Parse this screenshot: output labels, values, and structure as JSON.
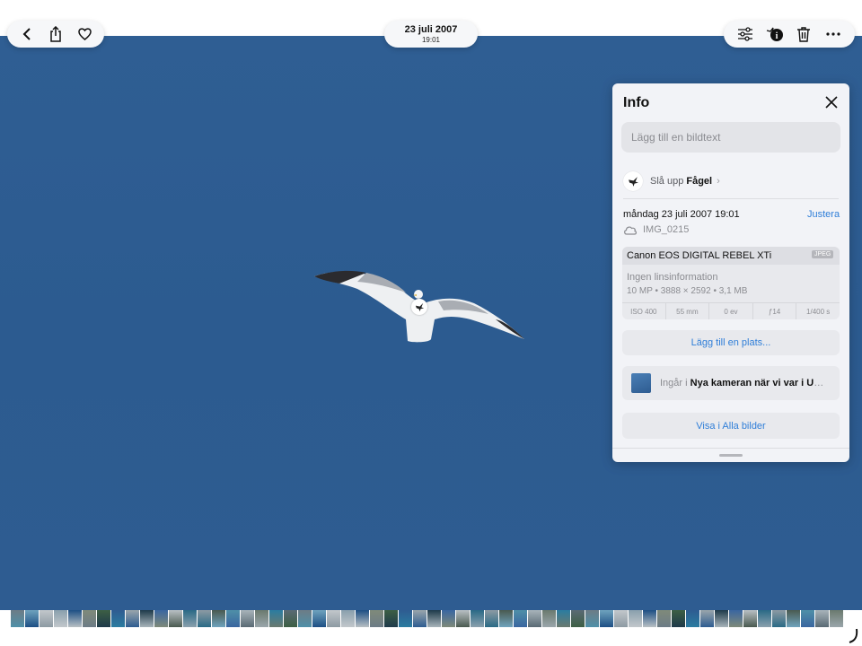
{
  "toolbar": {
    "date": "23 juli 2007",
    "time": "19:01",
    "back_icon": "chevron-left-icon",
    "share_icon": "share-icon",
    "favorite_icon": "heart-icon",
    "edit_icon": "sliders-icon",
    "info_icon": "info-visual-lookup-icon",
    "delete_icon": "trash-icon",
    "more_icon": "ellipsis-icon"
  },
  "info_panel": {
    "title": "Info",
    "caption_placeholder": "Lägg till en bildtext",
    "lookup_prefix": "Slå upp",
    "lookup_subject": "Fågel",
    "datetime": "måndag 23 juli 2007 19:01",
    "adjust_label": "Justera",
    "filename": "IMG_0215",
    "camera": "Canon EOS DIGITAL REBEL XTi",
    "format": "JPEG",
    "lens": "Ingen linsinformation",
    "specs": "10 MP • 3888 × 2592 • 3,1 MB",
    "exif": [
      "ISO 400",
      "55 mm",
      "0 ev",
      "ƒ14",
      "1/400 s"
    ],
    "add_place_label": "Lägg till en plats...",
    "album_prefix": "Ingår i",
    "album_name": "Nya kameran när vi var i US...",
    "show_all_label": "Visa i Alla bilder"
  },
  "colors": {
    "sky": "#2e5c91",
    "accent": "#2f7ed8",
    "panel": "#f2f3f7"
  }
}
